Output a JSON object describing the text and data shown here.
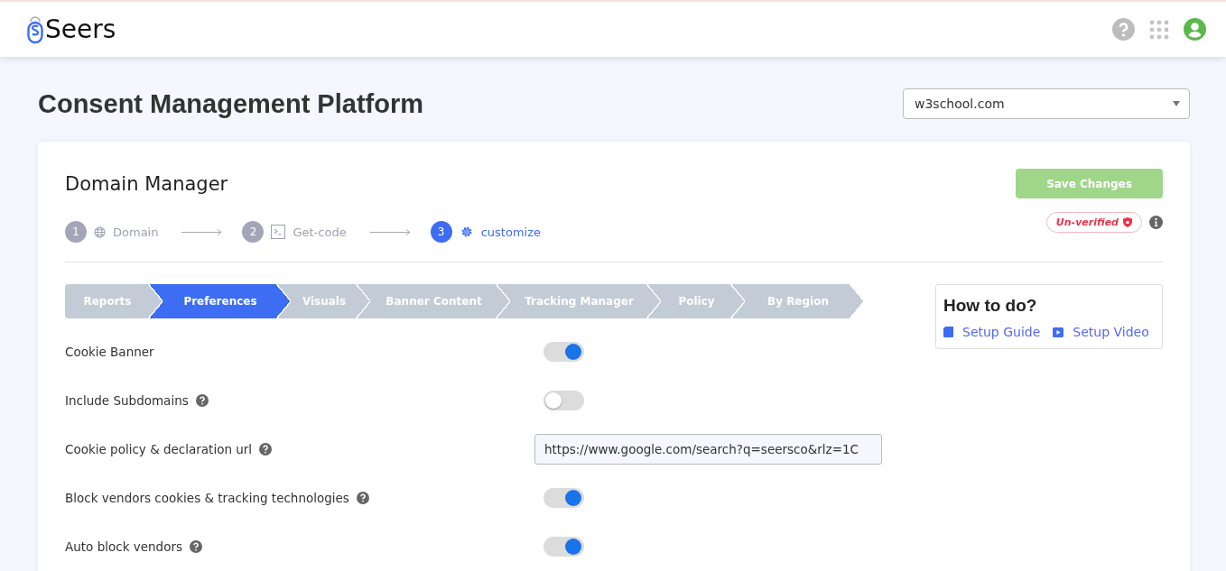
{
  "header": {
    "logo_text": "Seers"
  },
  "page": {
    "title": "Consent Management Platform",
    "domain_select": {
      "value": "w3school.com"
    }
  },
  "card": {
    "title": "Domain Manager",
    "save_button": {
      "label": "Save Changes",
      "disabled": true
    },
    "steps": [
      {
        "number": "1",
        "label": "Domain",
        "kind": "globe",
        "selected": false
      },
      {
        "number": "2",
        "label": "Get-code",
        "kind": "terminal",
        "selected": false
      },
      {
        "number": "3",
        "label": "customize",
        "kind": "gear",
        "selected": true
      }
    ],
    "status_badge": {
      "label": "Un-verified"
    },
    "tabs": [
      {
        "label": "Reports",
        "selected": false
      },
      {
        "label": "Preferences",
        "selected": true
      },
      {
        "label": "Visuals",
        "selected": false
      },
      {
        "label": "Banner Content",
        "selected": false
      },
      {
        "label": "Tracking Manager",
        "selected": false
      },
      {
        "label": "Policy",
        "selected": false
      },
      {
        "label": "By Region",
        "selected": false
      }
    ],
    "how_to": {
      "title": "How to do?",
      "links": [
        {
          "label": "Setup Guide",
          "kind": "book"
        },
        {
          "label": "Setup Video",
          "kind": "video"
        }
      ]
    },
    "settings": [
      {
        "label": "Cookie Banner",
        "kind": "toggle",
        "help": false,
        "on": true
      },
      {
        "label": "Include Subdomains",
        "kind": "toggle",
        "help": true,
        "on": false
      },
      {
        "label": "Cookie policy & declaration url",
        "kind": "text",
        "help": true,
        "value": "https://www.google.com/search?q=seersco&rlz=1C"
      },
      {
        "label": "Block vendors cookies & tracking technologies",
        "kind": "toggle",
        "help": true,
        "on": true
      },
      {
        "label": "Auto block vendors",
        "kind": "toggle",
        "help": true,
        "on": true
      }
    ]
  }
}
